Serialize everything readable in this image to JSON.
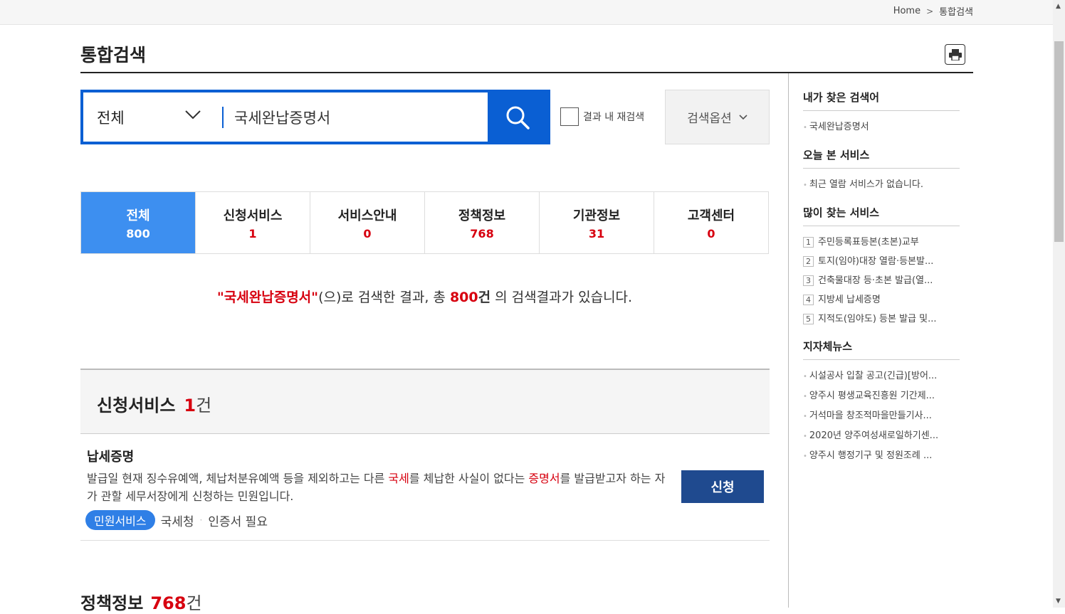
{
  "breadcrumb": {
    "home": "Home",
    "current": "통합검색"
  },
  "page": {
    "title": "통합검색"
  },
  "search": {
    "scope": "전체",
    "query": "국세완납증명서",
    "re_search_label": "결과 내 재검색",
    "options_label": "검색옵션"
  },
  "tabs": [
    {
      "label": "전체",
      "count": "800"
    },
    {
      "label": "신청서비스",
      "count": "1"
    },
    {
      "label": "서비스안내",
      "count": "0"
    },
    {
      "label": "정책정보",
      "count": "768"
    },
    {
      "label": "기관정보",
      "count": "31"
    },
    {
      "label": "고객센터",
      "count": "0"
    }
  ],
  "summary": {
    "keyword": "\"국세완납증명서\"",
    "text1": "(으)로 검색한 결과, 총 ",
    "total": "800",
    "unit": "건",
    "text2": " 의 검색결과가 있습니다."
  },
  "section1": {
    "title": "신청서비스",
    "count": "1",
    "unit": "건",
    "item": {
      "name": "납세증명",
      "desc1": "발급일 현재 징수유예액, 체납처분유예액 등을 제외하고는 다른 ",
      "hl1": "국세",
      "desc2": "를 체납한 사실이 없다는 ",
      "hl2": "증명서",
      "desc3": "를 발급받고자 하는 자가 관할 세무서장에게 신청하는 민원입니다.",
      "badge": "민원서비스",
      "agency": "국세청",
      "requirement": "인증서 필요",
      "apply_label": "신청"
    }
  },
  "section2": {
    "title": "정책정보",
    "count": "768",
    "unit": "건"
  },
  "sidebar": {
    "recent_keywords": {
      "title": "내가 찾은 검색어",
      "items": [
        "국세완납증명서"
      ]
    },
    "today_services": {
      "title": "오늘 본 서비스",
      "items": [
        "최근 열람 서비스가 없습니다."
      ]
    },
    "popular": {
      "title": "많이 찾는 서비스",
      "items": [
        {
          "rank": "1",
          "label": "주민등록표등본(초본)교부"
        },
        {
          "rank": "2",
          "label": "토지(임야)대장 열람·등본발..."
        },
        {
          "rank": "3",
          "label": "건축물대장 등·초본 발급(열..."
        },
        {
          "rank": "4",
          "label": "지방세 납세증명"
        },
        {
          "rank": "5",
          "label": "지적도(임야도) 등본 발급 및..."
        }
      ]
    },
    "local_news": {
      "title": "지자체뉴스",
      "items": [
        "시설공사 입찰 공고(긴급)[방어...",
        "양주시 평생교육진흥원 기간제...",
        "거석마을 창조적마을만들기사...",
        "2020년 양주여성새로일하기센...",
        "양주시 행정기구 및 정원조례 ..."
      ]
    }
  },
  "colors": {
    "primary": "#0a5fd3",
    "active_tab": "#3d8ff0",
    "accent_red": "#d7000f",
    "apply_button": "#1f4a8f"
  }
}
